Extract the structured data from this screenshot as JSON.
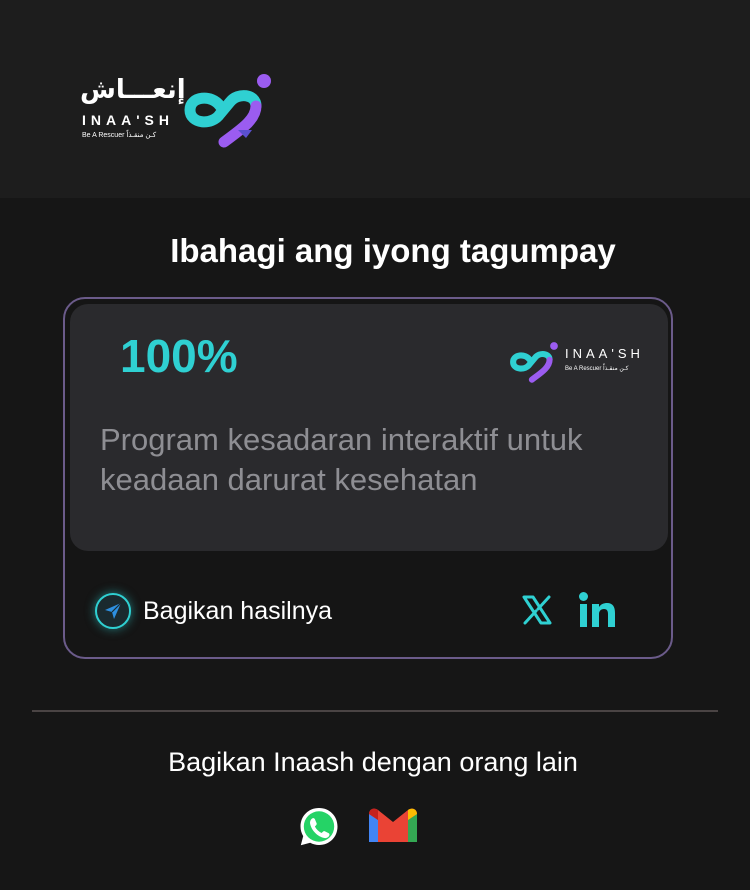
{
  "brand": {
    "arabic_name": "إنعـــاش",
    "latin_name": "INAA'SH",
    "tagline_en": "Be A Rescuer",
    "tagline_ar": "كـن منقـذاً"
  },
  "title": "Ibahagi ang iyong tagumpay",
  "card": {
    "percent": "100%",
    "description": "Program kesadaran interaktif untuk keadaan darurat kesehatan",
    "share_label": "Bagikan hasilnya"
  },
  "footer": {
    "share_app_label": "Bagikan Inaash dengan orang lain"
  },
  "colors": {
    "accent": "#2fd0d2",
    "purple": "#9b5cf0",
    "card_border": "#6b5b8a"
  },
  "icons": [
    "send-icon",
    "x-icon",
    "linkedin-icon",
    "whatsapp-icon",
    "gmail-icon"
  ]
}
